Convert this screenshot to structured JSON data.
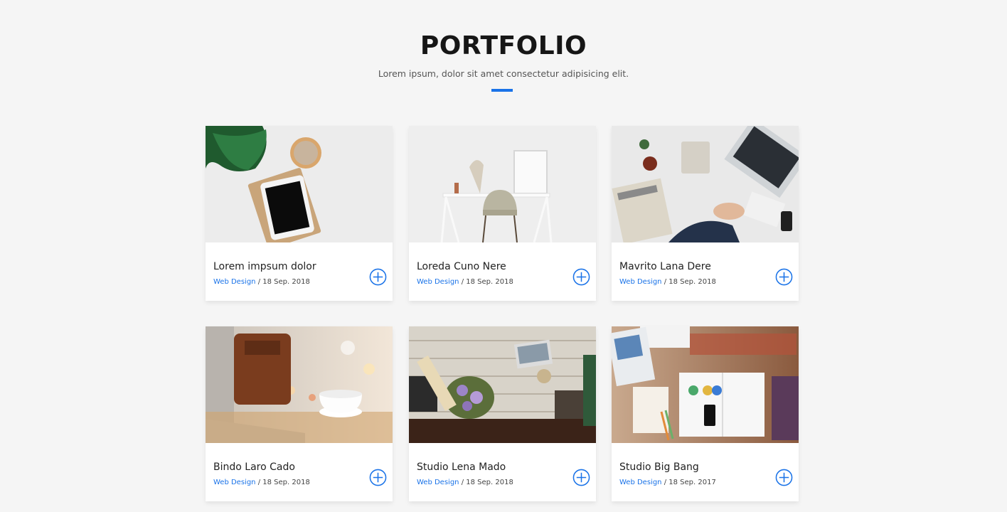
{
  "header": {
    "title": "PORTFOLIO",
    "subtitle": "Lorem ipsum, dolor sit amet consectetur adipisicing elit."
  },
  "colors": {
    "accent": "#1a73e8",
    "background": "#f5f5f5",
    "card": "#ffffff"
  },
  "cards": [
    {
      "title": "Lorem impsum dolor",
      "category": "Web Design",
      "separator": " / ",
      "date": "18 Sep. 2018",
      "image": "desk-plant-tablet-image",
      "icon": "plus-circle-icon"
    },
    {
      "title": "Loreda Cuno Nere",
      "category": "Web Design",
      "separator": " / ",
      "date": "18 Sep. 2018",
      "image": "white-desk-chair-image",
      "icon": "plus-circle-icon"
    },
    {
      "title": "Mavrito Lana Dere",
      "category": "Web Design",
      "separator": " / ",
      "date": "18 Sep. 2018",
      "image": "business-desk-laptop-image",
      "icon": "plus-circle-icon"
    },
    {
      "title": "Bindo Laro Cado",
      "category": "Web Design",
      "separator": " / ",
      "date": "18 Sep. 2018",
      "image": "laptop-bag-coffee-image",
      "icon": "plus-circle-icon"
    },
    {
      "title": "Studio Lena Mado",
      "category": "Web Design",
      "separator": " / ",
      "date": "18 Sep. 2018",
      "image": "wood-table-flowers-image",
      "icon": "plus-circle-icon"
    },
    {
      "title": "Studio Big Bang",
      "category": "Web Design",
      "separator": " / ",
      "date": "18 Sep. 2017",
      "image": "design-books-phone-image",
      "icon": "plus-circle-icon"
    }
  ]
}
